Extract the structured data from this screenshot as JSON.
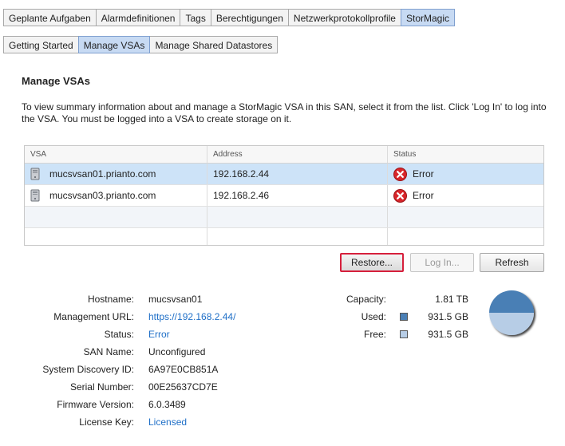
{
  "top_tabs": [
    "Geplante Aufgaben",
    "Alarmdefinitionen",
    "Tags",
    "Berechtigungen",
    "Netzwerkprotokollprofile",
    "StorMagic"
  ],
  "sub_tabs": [
    "Getting Started",
    "Manage VSAs",
    "Manage Shared Datastores"
  ],
  "page_title": "Manage VSAs",
  "description": "To view summary information about and manage a StorMagic VSA in this SAN, select it from the list. Click 'Log In' to log into the VSA. You must be logged into a VSA to create storage on it.",
  "table": {
    "columns": [
      "VSA",
      "Address",
      "Status"
    ],
    "rows": [
      {
        "vsa": "mucsvsan01.prianto.com",
        "address": "192.168.2.44",
        "status": "Error",
        "selected": true
      },
      {
        "vsa": "mucsvsan03.prianto.com",
        "address": "192.168.2.46",
        "status": "Error",
        "selected": false
      }
    ]
  },
  "buttons": {
    "restore": "Restore...",
    "login": "Log In...",
    "refresh": "Refresh"
  },
  "details": {
    "hostname_label": "Hostname:",
    "hostname": "mucsvsan01",
    "url_label": "Management URL:",
    "url": "https://192.168.2.44/",
    "status_label": "Status:",
    "status": "Error",
    "san_label": "SAN Name:",
    "san": "Unconfigured",
    "sysid_label": "System Discovery ID:",
    "sysid": "6A97E0CB851A",
    "serial_label": "Serial Number:",
    "serial": "00E25637CD7E",
    "firmware_label": "Firmware Version:",
    "firmware": "6.0.3489",
    "license_label": "License Key:",
    "license": "Licensed"
  },
  "capacity": {
    "capacity_label": "Capacity:",
    "capacity": "1.81 TB",
    "used_label": "Used:",
    "used": "931.5 GB",
    "free_label": "Free:",
    "free": "931.5 GB",
    "used_color": "#4a7fb5",
    "free_color": "#b7cde6"
  },
  "chart_data": {
    "type": "pie",
    "slices": [
      {
        "label": "Used",
        "value": 931.5,
        "color": "#4a7fb5"
      },
      {
        "label": "Free",
        "value": 931.5,
        "color": "#b7cde6"
      }
    ]
  },
  "icons": {
    "vsa_row": "server-icon",
    "status_error": "error-icon"
  },
  "colors": {
    "accent": "#c7daf3",
    "link": "#1f6fc7",
    "selected_row": "#cde3f8",
    "error": "#d8262b"
  }
}
